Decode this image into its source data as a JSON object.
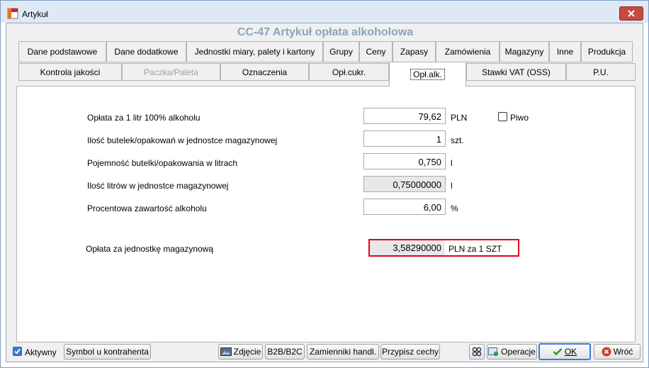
{
  "window": {
    "title": "Artykuł"
  },
  "heading": "CC-47  Artykuł opłata alkoholowa",
  "tabs_row1": [
    "Dane podstawowe",
    "Dane dodatkowe",
    "Jednostki miary, palety i kartony",
    "Grupy",
    "Ceny",
    "Zapasy",
    "Zamówienia",
    "Magazyny",
    "Inne",
    "Produkcja"
  ],
  "tabs_row2": [
    "Kontrola jakości",
    "Paczka/Paleta",
    "Oznaczenia",
    "Opł.cukr.",
    "Opł.alk.",
    "Stawki VAT (OSS)",
    "P.U."
  ],
  "form": {
    "rows": [
      {
        "label": "Opłata za 1 litr 100% alkoholu",
        "value": "79,62",
        "unit": "PLN"
      },
      {
        "label": "Ilość butelek/opakowań w jednostce magazynowej",
        "value": "1",
        "unit": "szt."
      },
      {
        "label": "Pojemność butelki/opakowania w litrach",
        "value": "0,750",
        "unit": "l"
      },
      {
        "label": "Ilość litrów w jednostce magazynowej",
        "value": "0,75000000",
        "unit": "l"
      },
      {
        "label": "Procentowa zawartość alkoholu",
        "value": "6,00",
        "unit": "%"
      }
    ],
    "piwo_label": "Piwo",
    "fee_label": "Opłata za jednostkę magazynową",
    "fee_value": "3,58290000",
    "fee_unit": "PLN za 1 SZT"
  },
  "footer": {
    "aktywny_label": "Aktywny",
    "symbol_button": "Symbol u kontrahenta",
    "zdjecie_button": "Zdjęcie",
    "b2b_button": "B2B/B2C",
    "zamienniki_button": "Zamienniki handl.",
    "przypisz_button": "Przypisz cechy",
    "operacje_button": "Operacje",
    "ok_button": "OK",
    "wroc_button": "Wróć"
  },
  "colors": {
    "accent": "#3c7be0",
    "highlight": "#e0001a",
    "heading": "#8da2c2"
  }
}
